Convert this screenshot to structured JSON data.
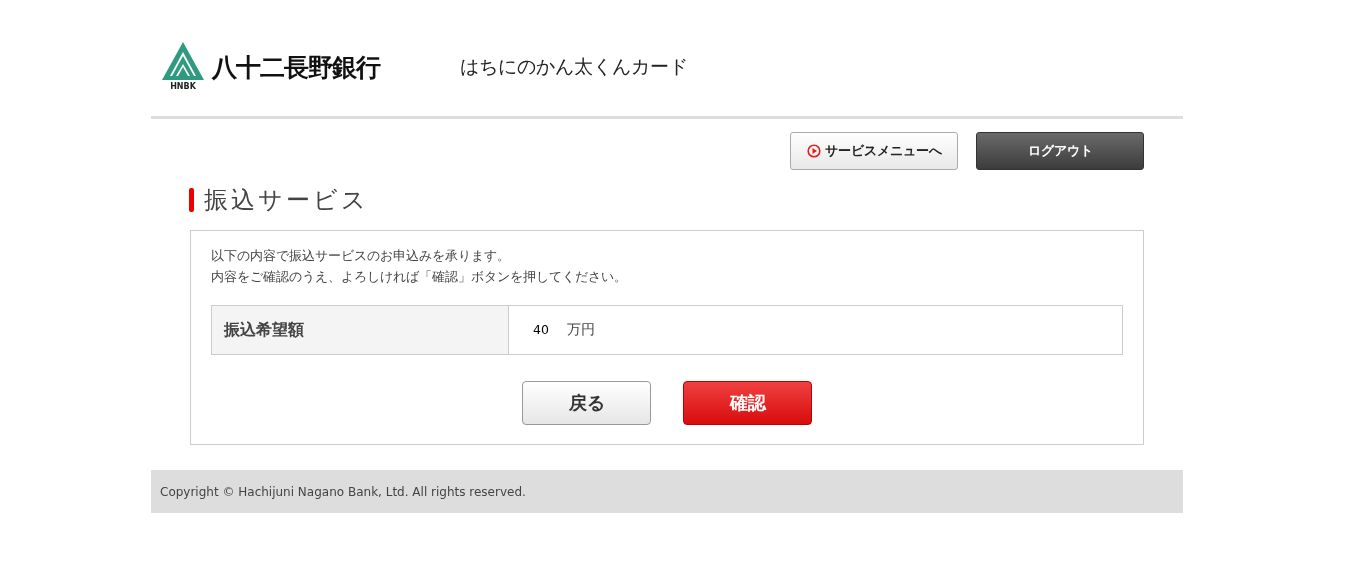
{
  "header": {
    "logo_mark": "HNBK",
    "bank_name": "八十二長野銀行",
    "service_name": "はちにのかん太くんカード"
  },
  "nav_buttons": [
    {
      "kind": "menu",
      "label": "サービスメニューへ"
    },
    {
      "kind": "logout",
      "label": "ログアウト"
    }
  ],
  "page_title": "振込サービス",
  "messages": [
    "以下の内容で振込サービスのお申込みを承ります。",
    "内容をご確認のうえ、よろしければ「確認」ボタンを押してください。"
  ],
  "form_rows": [
    {
      "label": "振込希望額",
      "value": "40",
      "unit": "万円"
    }
  ],
  "actions": [
    {
      "kind": "back",
      "label": "戻る"
    },
    {
      "kind": "confirm",
      "label": "確認"
    }
  ],
  "footer": "Copyright © Hachijuni Nagano Bank, Ltd. All rights reserved."
}
